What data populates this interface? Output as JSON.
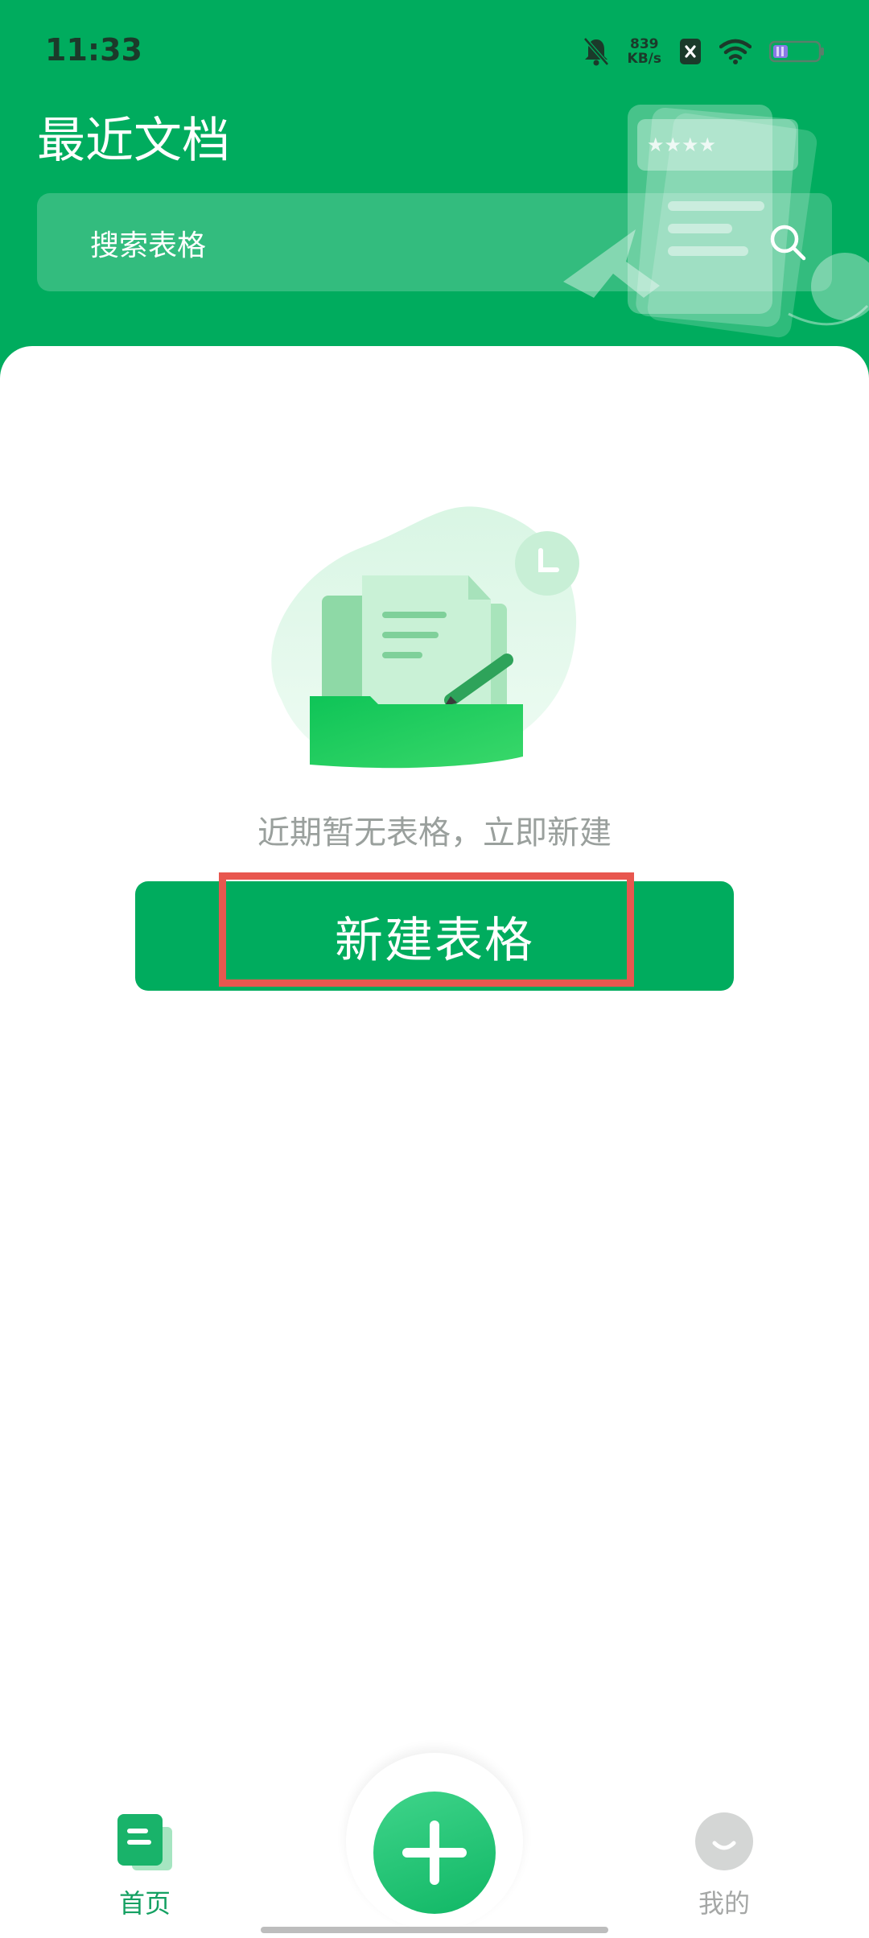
{
  "status_bar": {
    "time": "11:33",
    "net_speed_value": "839",
    "net_speed_unit": "KB/s",
    "icons": [
      "bell-muted-icon",
      "sim-x-icon",
      "wifi-icon",
      "battery-icon"
    ]
  },
  "header": {
    "title": "最近文档",
    "search_placeholder": "搜索表格"
  },
  "empty_state": {
    "message": "近期暂无表格，立即新建",
    "button_label": "新建表格"
  },
  "bottom_nav": {
    "home_label": "首页",
    "mine_label": "我的"
  },
  "colors": {
    "brand_green": "#00ac5e",
    "highlight_red": "#e8574f"
  }
}
